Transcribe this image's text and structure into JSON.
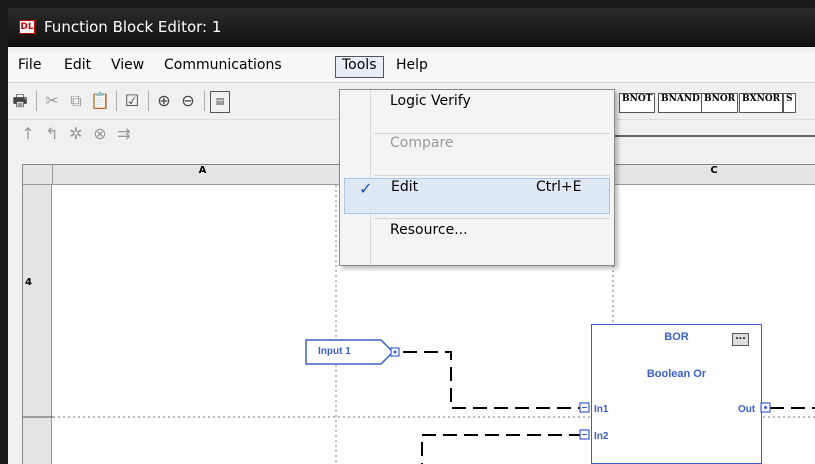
{
  "window": {
    "title": "Function Block Editor: 1",
    "app_icon": "DL"
  },
  "menubar": {
    "items": [
      "File",
      "Edit",
      "View",
      "Communications",
      "Tools",
      "Help"
    ],
    "active": "Tools"
  },
  "toolbar": {
    "block_buttons": [
      "BNOT",
      "BNAND",
      "BNOR",
      "BXNOR",
      "S"
    ]
  },
  "grid": {
    "columns": [
      "A",
      "C"
    ],
    "row_label": "4"
  },
  "diagram": {
    "input_tag": "Input 1",
    "block": {
      "name": "BOR",
      "description": "Boolean Or",
      "more_button": "...",
      "pins": {
        "in1": "In1",
        "in2": "In2",
        "out": "Out"
      }
    }
  },
  "tools_menu": {
    "items": [
      {
        "label": "Logic Verify",
        "shortcut": "",
        "enabled": true,
        "checked": false
      },
      {
        "label": "Compare",
        "shortcut": "",
        "enabled": false,
        "checked": false
      },
      {
        "label": "Edit",
        "shortcut": "Ctrl+E",
        "enabled": true,
        "checked": true
      },
      {
        "label": "Resource...",
        "shortcut": "",
        "enabled": true,
        "checked": false
      }
    ],
    "check_mark": "✓"
  }
}
